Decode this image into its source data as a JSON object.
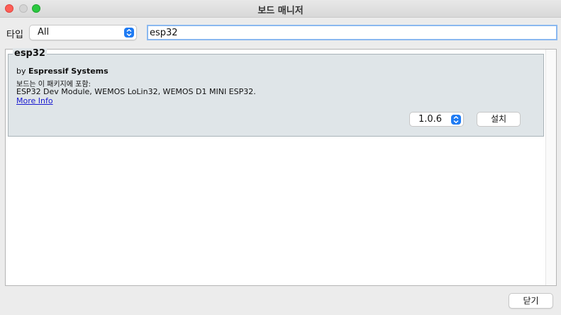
{
  "window": {
    "title": "보드 매니저"
  },
  "filter": {
    "type_label": "타입",
    "type_selected": "All",
    "search_value": "esp32"
  },
  "board": {
    "name": "esp32",
    "by_prefix": "by ",
    "author": "Espressif Systems",
    "included_label": "보드는 이 패키지에 포함:",
    "boards_list": "ESP32 Dev Module, WEMOS LoLin32, WEMOS D1 MINI ESP32.",
    "more_info": "More Info",
    "version_selected": "1.0.6",
    "install_label": "설치"
  },
  "footer": {
    "close_label": "닫기"
  },
  "colors": {
    "accent": "#1f7bf3",
    "close_dot": "#fe5f57",
    "zoom_dot": "#2bc840",
    "entry_bg": "#dfe5e8",
    "link": "#1a1ad0"
  }
}
